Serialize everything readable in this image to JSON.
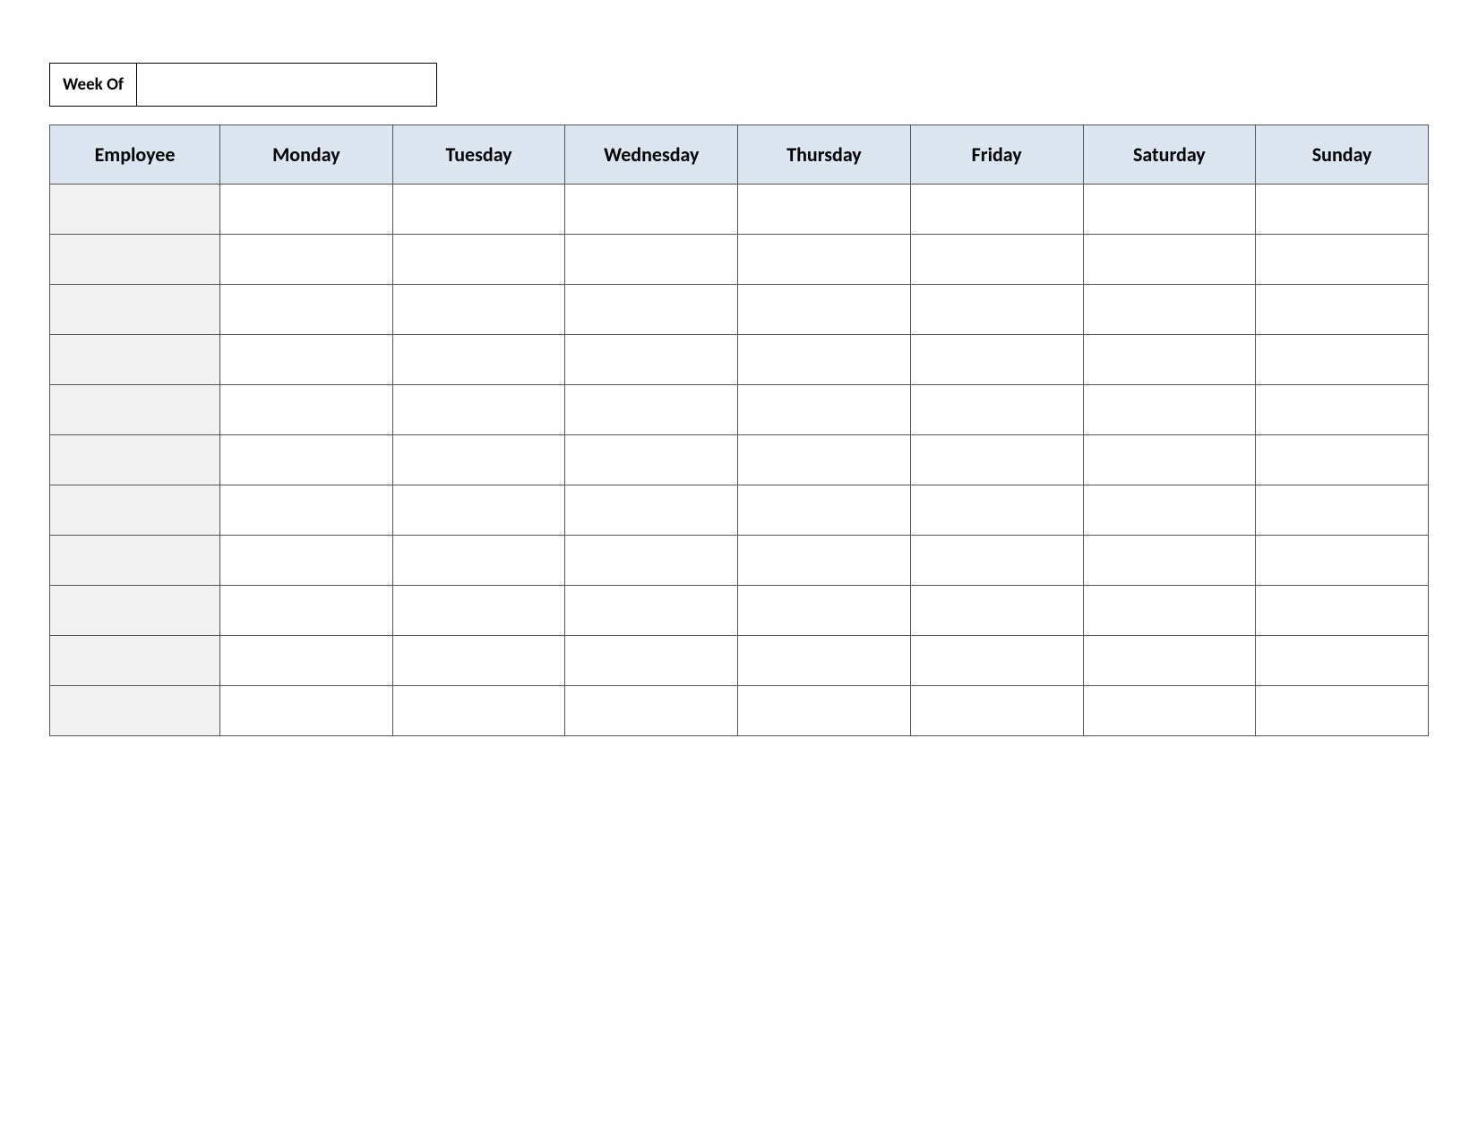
{
  "week_of": {
    "label": "Week Of",
    "value": ""
  },
  "columns": {
    "employee": "Employee",
    "mon": "Monday",
    "tue": "Tuesday",
    "wed": "Wednesday",
    "thu": "Thursday",
    "fri": "Friday",
    "sat": "Saturday",
    "sun": "Sunday"
  },
  "rows": [
    {
      "employee": "",
      "mon": "",
      "tue": "",
      "wed": "",
      "thu": "",
      "fri": "",
      "sat": "",
      "sun": ""
    },
    {
      "employee": "",
      "mon": "",
      "tue": "",
      "wed": "",
      "thu": "",
      "fri": "",
      "sat": "",
      "sun": ""
    },
    {
      "employee": "",
      "mon": "",
      "tue": "",
      "wed": "",
      "thu": "",
      "fri": "",
      "sat": "",
      "sun": ""
    },
    {
      "employee": "",
      "mon": "",
      "tue": "",
      "wed": "",
      "thu": "",
      "fri": "",
      "sat": "",
      "sun": ""
    },
    {
      "employee": "",
      "mon": "",
      "tue": "",
      "wed": "",
      "thu": "",
      "fri": "",
      "sat": "",
      "sun": ""
    },
    {
      "employee": "",
      "mon": "",
      "tue": "",
      "wed": "",
      "thu": "",
      "fri": "",
      "sat": "",
      "sun": ""
    },
    {
      "employee": "",
      "mon": "",
      "tue": "",
      "wed": "",
      "thu": "",
      "fri": "",
      "sat": "",
      "sun": ""
    },
    {
      "employee": "",
      "mon": "",
      "tue": "",
      "wed": "",
      "thu": "",
      "fri": "",
      "sat": "",
      "sun": ""
    },
    {
      "employee": "",
      "mon": "",
      "tue": "",
      "wed": "",
      "thu": "",
      "fri": "",
      "sat": "",
      "sun": ""
    },
    {
      "employee": "",
      "mon": "",
      "tue": "",
      "wed": "",
      "thu": "",
      "fri": "",
      "sat": "",
      "sun": ""
    },
    {
      "employee": "",
      "mon": "",
      "tue": "",
      "wed": "",
      "thu": "",
      "fri": "",
      "sat": "",
      "sun": ""
    }
  ]
}
